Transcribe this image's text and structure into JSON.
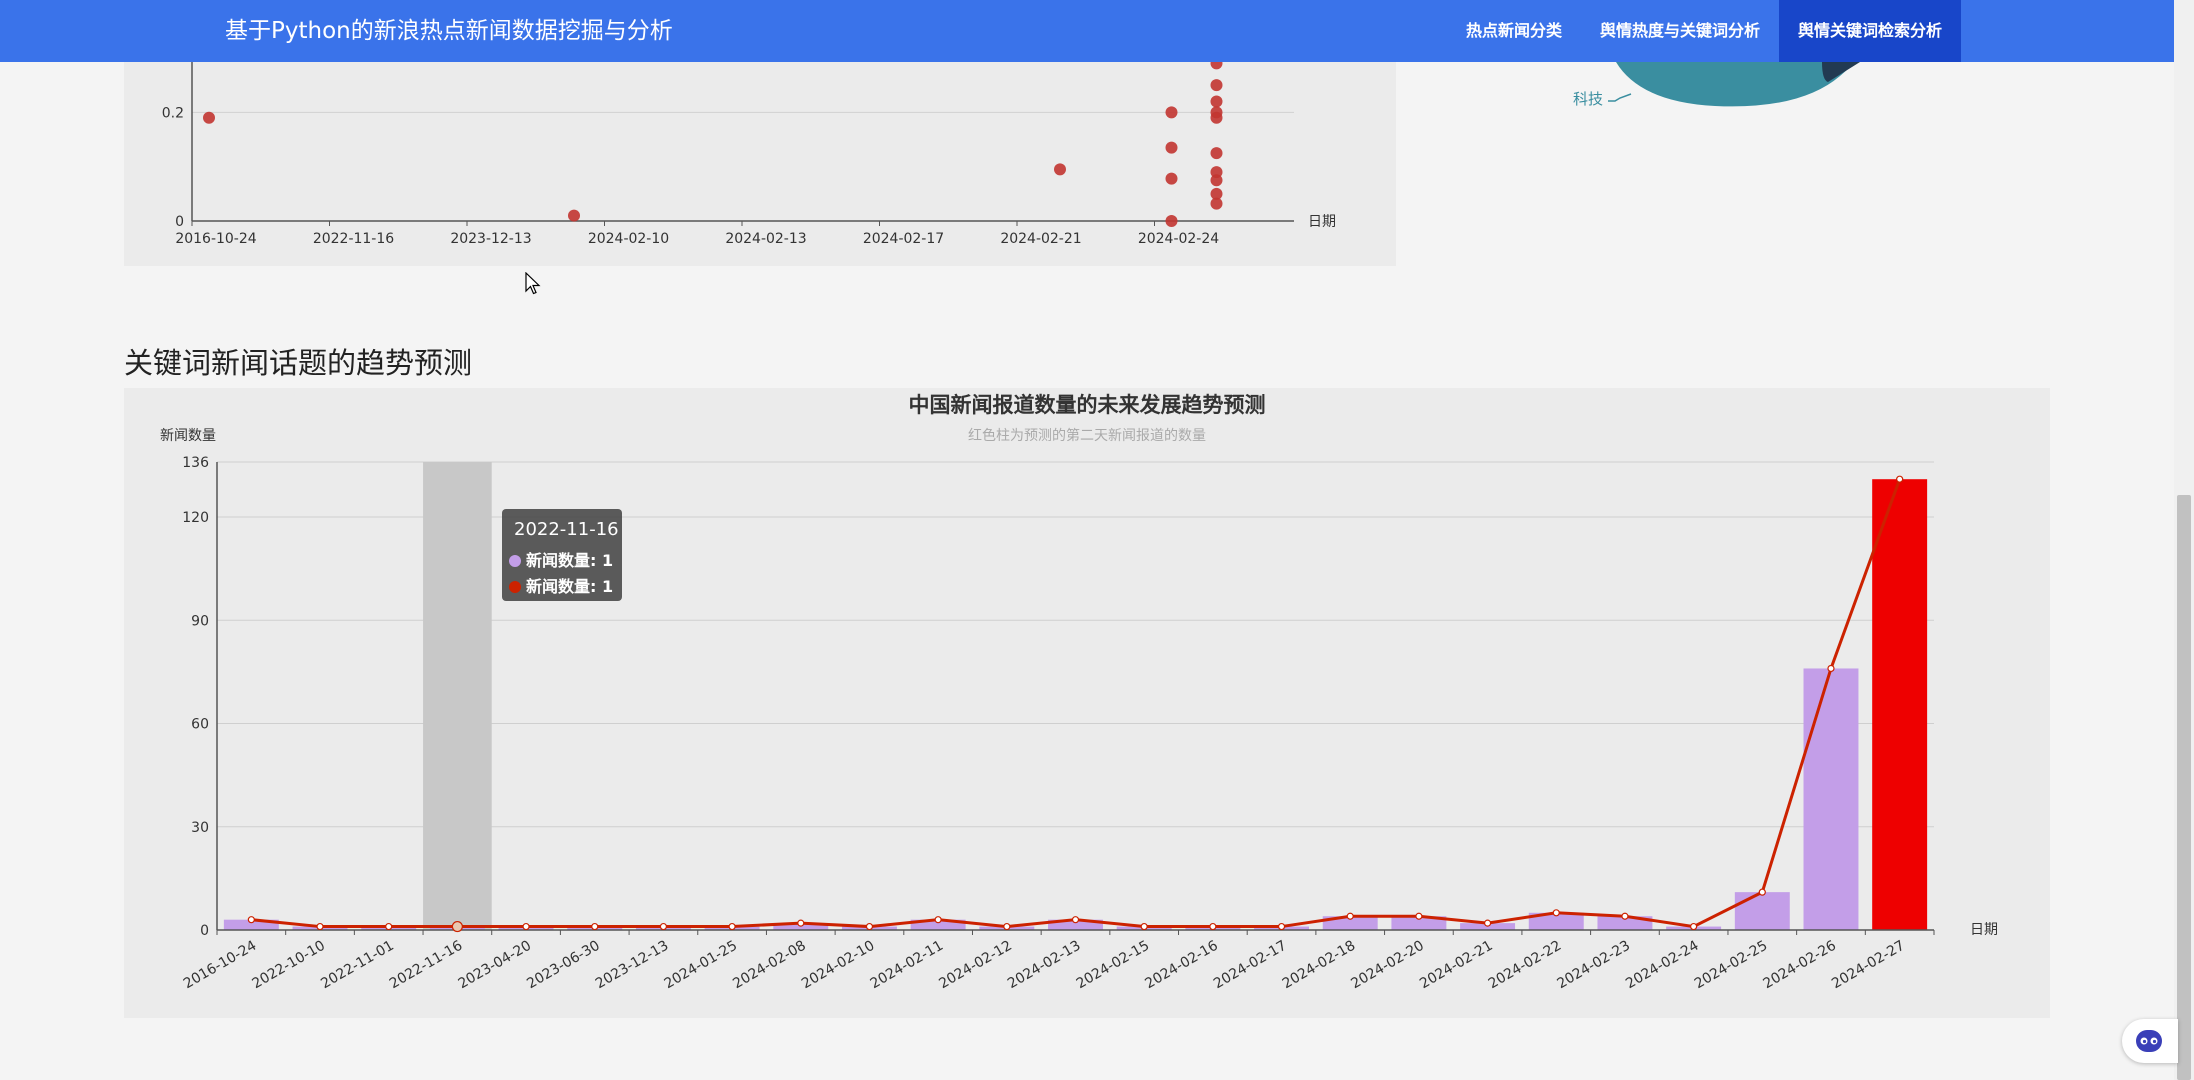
{
  "header": {
    "title": "基于Python的新浪热点新闻数据挖掘与分析",
    "nav": [
      {
        "label": "热点新闻分类",
        "active": false
      },
      {
        "label": "舆情热度与关键词分析",
        "active": false
      },
      {
        "label": "舆情关键词检索分析",
        "active": true
      }
    ]
  },
  "colors": {
    "header_bg": "#3a73ea",
    "nav_active_bg": "#1846c9",
    "scatter_point": "#c23531",
    "bar": "#c39ee8",
    "predicted_bar": "#ee0000",
    "line": "#cc2200",
    "pie": "#3a8ea0"
  },
  "pie_fragment": {
    "label": "科技"
  },
  "scatter_chart": {
    "xlabel": "日期",
    "yticks": [
      "0",
      "0.2"
    ],
    "xticks": [
      "2016-10-24",
      "2022-11-16",
      "2023-12-13",
      "2024-02-10",
      "2024-02-13",
      "2024-02-17",
      "2024-02-21",
      "2024-02-24"
    ]
  },
  "section_title": "关键词新闻话题的趋势预测",
  "trend_chart": {
    "title": "中国新闻报道数量的未来发展趋势预测",
    "subtitle": "红色柱为预测的第二天新闻报道的数量",
    "ylabel": "新闻数量",
    "xlabel": "日期",
    "yticks": [
      "0",
      "30",
      "60",
      "90",
      "120",
      "136"
    ]
  },
  "chart_data": [
    {
      "type": "scatter",
      "xlabel": "日期",
      "x_categories": [
        "2016-10-24",
        "2022-11-16",
        "2023-12-13",
        "2024-02-10",
        "2024-02-13",
        "2024-02-17",
        "2024-02-21",
        "2024-02-24"
      ],
      "ylim": [
        0,
        0.3
      ],
      "points": [
        {
          "x": "2016-10-24",
          "y": 0.19
        },
        {
          "x": "2023-12-13",
          "y": 0.01
        },
        {
          "x": "2024-02-21",
          "y": 0.095
        },
        {
          "x": "2024-02-24",
          "y": 0.31
        },
        {
          "x": "2024-02-24",
          "y": 0.2
        },
        {
          "x": "2024-02-24",
          "y": 0.135
        },
        {
          "x": "2024-02-24",
          "y": 0.078
        },
        {
          "x": "2024-02-24",
          "y": 0.0
        },
        {
          "x": "2024-02-24+",
          "y": 0.29
        },
        {
          "x": "2024-02-24+",
          "y": 0.25
        },
        {
          "x": "2024-02-24+",
          "y": 0.22
        },
        {
          "x": "2024-02-24+",
          "y": 0.2
        },
        {
          "x": "2024-02-24+",
          "y": 0.19
        },
        {
          "x": "2024-02-24+",
          "y": 0.125
        },
        {
          "x": "2024-02-24+",
          "y": 0.09
        },
        {
          "x": "2024-02-24+",
          "y": 0.075
        },
        {
          "x": "2024-02-24+",
          "y": 0.05
        },
        {
          "x": "2024-02-24+",
          "y": 0.032
        }
      ],
      "grid": true
    },
    {
      "type": "bar",
      "title": "中国新闻报道数量的未来发展趋势预测",
      "subtitle": "红色柱为预测的第二天新闻报道的数量",
      "xlabel": "日期",
      "ylabel": "新闻数量",
      "ylim": [
        0,
        136
      ],
      "categories": [
        "2016-10-24",
        "2022-10-10",
        "2022-11-01",
        "2022-11-16",
        "2023-04-20",
        "2023-06-30",
        "2023-12-13",
        "2024-01-25",
        "2024-02-08",
        "2024-02-10",
        "2024-02-11",
        "2024-02-12",
        "2024-02-13",
        "2024-02-15",
        "2024-02-16",
        "2024-02-17",
        "2024-02-18",
        "2024-02-20",
        "2024-02-21",
        "2024-02-22",
        "2024-02-23",
        "2024-02-24",
        "2024-02-25",
        "2024-02-26",
        "2024-02-27"
      ],
      "series": [
        {
          "name": "新闻数量",
          "kind": "bar",
          "values": [
            3,
            1,
            1,
            1,
            1,
            1,
            1,
            1,
            2,
            1,
            3,
            1,
            3,
            1,
            1,
            1,
            4,
            4,
            2,
            5,
            4,
            1,
            11,
            76,
            131
          ]
        },
        {
          "name": "新闻数量",
          "kind": "line",
          "values": [
            3,
            1,
            1,
            1,
            1,
            1,
            1,
            1,
            2,
            1,
            3,
            1,
            3,
            1,
            1,
            1,
            4,
            4,
            2,
            5,
            4,
            1,
            11,
            76,
            131
          ]
        }
      ],
      "predicted_index": 24,
      "highlight_index": 3,
      "legend": "none",
      "grid": true
    }
  ],
  "tooltip": {
    "title": "2022-11-16",
    "rows": [
      "新闻数量: 1",
      "新闻数量: 1"
    ]
  }
}
